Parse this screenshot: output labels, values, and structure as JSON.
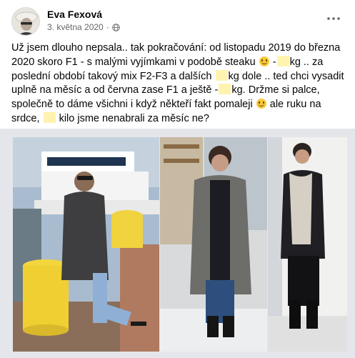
{
  "post": {
    "author_name": "Eva Fexová",
    "timestamp": "3. května 2020",
    "meta_separator": "·",
    "audience_icon": "globe-icon",
    "more_icon": "more-options-icon",
    "text": {
      "l1": "Už jsem dlouho nepsala.. tak pokračování: od listopadu 2019 do března",
      "l2a": "2020 skoro F1 - s malými vyjímkami v podobě steaku",
      "l2b": "-",
      "l2c": "kg .. za",
      "l3a": "poslední období takový mix F2-F3 a dalších",
      "l3b": "kg dole .. ted chci vysadit",
      "l4a": "uplně na měsíc a od června zase F1 a ještě -",
      "l4b": "kg. Držme si palce,",
      "l5a": "společně to dáme všichni i když někteří fakt pomaleji",
      "l5b": "ale ruku na",
      "l6a": "srdce,",
      "l6b": "kilo jsme nenabrali za měsíc ne?"
    },
    "emoji_names": [
      "slightly-smiling-face-emoji",
      "slightly-smiling-face-emoji"
    ]
  },
  "colors": {
    "text_primary": "#050505",
    "text_secondary": "#65676b",
    "redaction_highlight": "#fff3b0",
    "photo_frame": "#e4e6eb"
  }
}
